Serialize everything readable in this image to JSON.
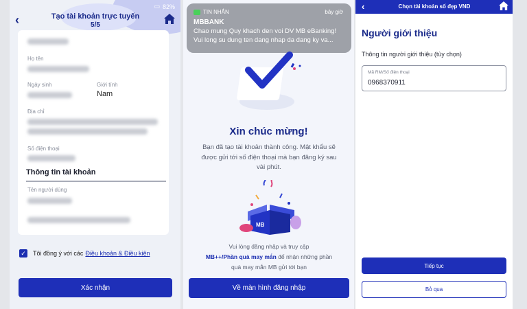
{
  "left_screen": {
    "status_battery": "82%",
    "header": {
      "title": "Tạo tài khoản trực tuyến",
      "step": "5/5"
    },
    "form": {
      "hoten_label": "Họ tên",
      "ngaysinh_label": "Ngày sinh",
      "gioitinh_label": "Giới tính",
      "gioitinh_value": "Nam",
      "diachi_label": "Địa chỉ",
      "sdt_label": "Số điện thoại",
      "account_section": "Thông tin tài khoản",
      "username_label": "Tên người dùng"
    },
    "agreement": {
      "text": "Tôi đồng ý với các",
      "link": "Điều khoản & Điều kiện"
    },
    "confirm_button": "Xác nhận"
  },
  "middle_screen": {
    "notification": {
      "app": "TIN NHẮN",
      "time": "bây giờ",
      "sender": "MBBANK",
      "line1": "Chao mung Quy khach den voi DV MB eBanking!",
      "line2": "Vui long su dung ten dang nhap da dang ky va..."
    },
    "title": "Xin chúc mừng!",
    "description": "Bạn đã tạo tài khoản thành công. Mật khẩu sẽ được gửi tới số điện thoại mà bạn đăng ký sau vài phút.",
    "gift_label": "MB",
    "hint": {
      "line1": "Vui lòng đăng nhập và truy cập",
      "emphasis": "MB++/Phần quà may mắn",
      "line2_rest": "để nhận những phần",
      "line3": "quà may mắn MB gửi tới bạn"
    },
    "login_button": "Về màn hình đăng nhập"
  },
  "right_screen": {
    "header_title": "Chọn tài khoản số đẹp VND",
    "heading": "Người giới thiệu",
    "subtitle": "Thông tin người giới thiệu (tùy chọn)",
    "referral_field": {
      "label": "Mã RM/Số điện thoại",
      "value": "0968370911"
    },
    "continue_button": "Tiếp tục",
    "skip_button": "Bỏ qua"
  },
  "colors": {
    "brand_blue": "#1e2fb8",
    "title_navy": "#1a2a8a",
    "checkmark_blue": "#2233c4"
  },
  "icons": [
    "back-arrow-icon",
    "home-icon",
    "checkbox-checked-icon",
    "message-icon",
    "gift-box-icon",
    "checkmark-icon"
  ]
}
